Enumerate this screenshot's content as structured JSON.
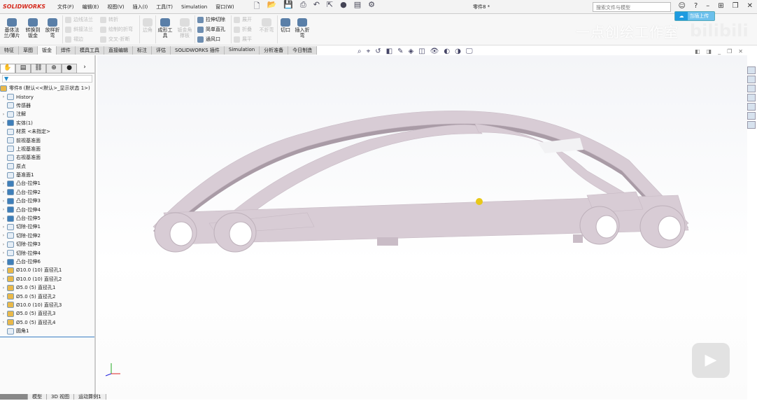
{
  "app": {
    "logo": "SOLIDWORKS",
    "doc_title": "零件8 *"
  },
  "menu": [
    "文件(F)",
    "编辑(E)",
    "视图(V)",
    "插入(I)",
    "工具(T)",
    "Simulation",
    "窗口(W)"
  ],
  "search": {
    "placeholder": "搜索文件与模型"
  },
  "upload": {
    "label": "当插上传"
  },
  "watermark": {
    "text": "一点创绘工作室",
    "brand": "bilibili"
  },
  "ribbon": {
    "big": [
      "基体法兰/薄片",
      "转换到钣金",
      "放样折弯",
      "边角",
      "成形工具",
      "钣金角撑板",
      "不折弯",
      "切口",
      "插入折弯"
    ],
    "small": [
      "边线法兰",
      "斜接法兰",
      "褶边",
      "转折",
      "绘制的折弯",
      "交叉-折断",
      "拉伸切除",
      "简单直孔",
      "通风口",
      "展开",
      "折叠",
      "展平"
    ]
  },
  "tabs": [
    "特征",
    "草图",
    "钣金",
    "焊件",
    "模具工具",
    "直接编辑",
    "标注",
    "评估",
    "SOLIDWORKS 插件",
    "Simulation",
    "分析准备",
    "今日制造"
  ],
  "active_tab": "钣金",
  "tree": {
    "root": "零件8 (默认<<默认>_显示状态 1>)",
    "items": [
      "History",
      "传感器",
      "注解",
      "实体(1)",
      "材质 <未指定>",
      "前视基准面",
      "上视基准面",
      "右视基准面",
      "原点",
      "基准面1",
      "凸台-拉伸1",
      "凸台-拉伸2",
      "凸台-拉伸3",
      "凸台-拉伸4",
      "凸台-拉伸5",
      "切除-拉伸1",
      "切除-拉伸2",
      "切除-拉伸3",
      "切除-拉伸4",
      "凸台-拉伸6",
      "Ø10.0 (10) 直径孔1",
      "Ø10.0 (10) 直径孔2",
      "Ø5.0 (5) 直径孔1",
      "Ø5.0 (5) 直径孔2",
      "Ø10.0 (10) 直径孔3",
      "Ø5.0 (5) 直径孔3",
      "Ø5.0 (5) 直径孔4",
      "圆角1"
    ]
  },
  "bottom_tabs": [
    "模型",
    "3D 视图",
    "运动算例1"
  ],
  "colors": {
    "part": "#d8ccd5",
    "part_shadow": "#a99ba6",
    "accent": "#1e88c8"
  }
}
